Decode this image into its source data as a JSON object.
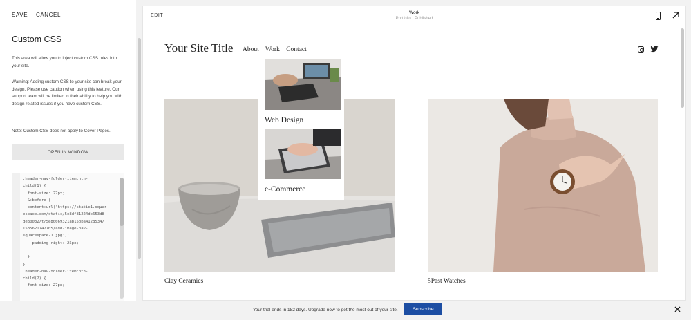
{
  "toolbar": {
    "save_label": "SAVE",
    "cancel_label": "CANCEL"
  },
  "panel": {
    "title": "Custom CSS",
    "description": "This area will allow you to inject custom CSS rules into your site.",
    "warning": "Warning: Adding custom CSS to your site can break your design. Please use caution when using this feature. Our support team will be limited in their ability to help you with design related issues if you have custom CSS.",
    "note": "Note: Custom CSS does not apply to Cover Pages.",
    "open_button": "OPEN IN WINDOW"
  },
  "editor": {
    "code": ".header-nav-folder-item:nth-\nchild(1) {\n  font-size: 27px;\n  &:before {\n  content:url('https://static1.squar\nespace.com/static/5e8df81224de653d8\nde80032/t/5e80669321ab15bba4128534/\n1585621747705/add-image-nav-\nsquarespace-1.jpg');\n    padding-right: 25px;\n\n  }\n}\n.header-nav-folder-item:nth-\nchild(2) {\n  font-size: 27px;"
  },
  "preview": {
    "edit_label": "EDIT",
    "page_name": "Work",
    "page_status": "Portfolio · Published",
    "site_title": "Your Site Title",
    "nav": [
      "About",
      "Work",
      "Contact"
    ],
    "dropdown": [
      "Web Design",
      "e-Commerce"
    ],
    "projects": [
      {
        "title": "Clay Ceramics"
      },
      {
        "title": "5Past Watches"
      }
    ]
  },
  "footer": {
    "trial_text": "Your trial ends in 182 days. Upgrade now to get the most out of your site.",
    "subscribe_label": "Subscribe"
  },
  "icons": [
    "phone-icon",
    "expand-icon",
    "instagram-icon",
    "twitter-icon",
    "close-icon"
  ],
  "colors": {
    "accent": "#1d4ea3",
    "panel_bg": "#ffffff",
    "app_bg": "#f2f2f2"
  }
}
